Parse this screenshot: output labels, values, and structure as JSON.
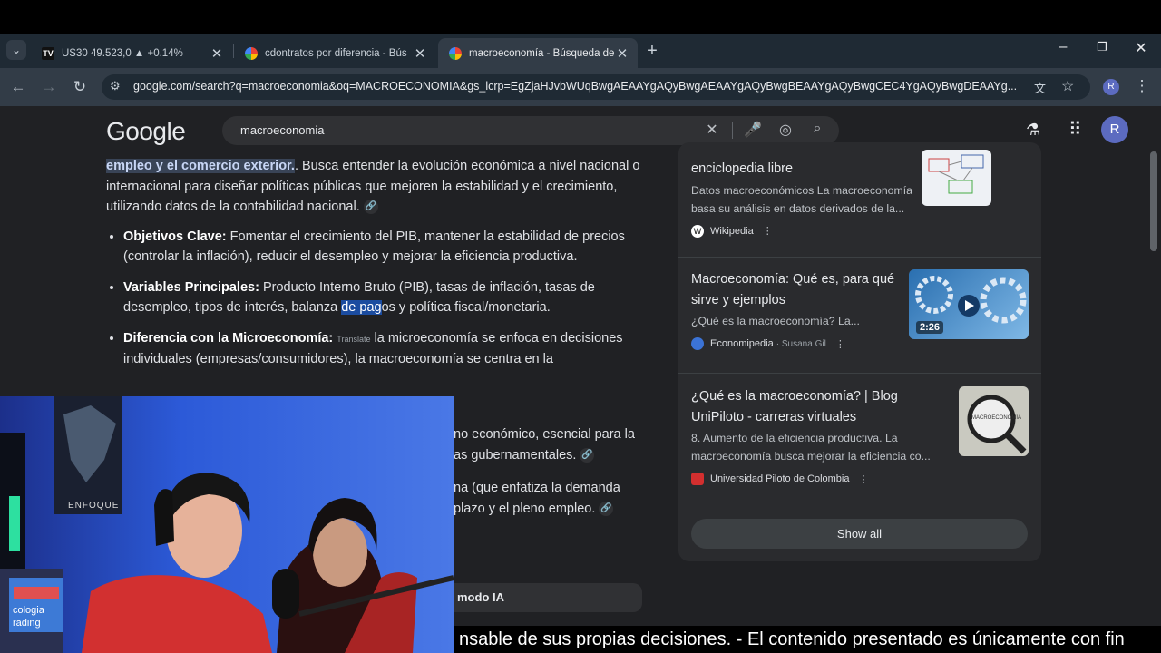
{
  "browser": {
    "tabs": [
      {
        "title": "US30 49.523,0 ▲ +0.14%",
        "active": false
      },
      {
        "title": "cdontratos por diferencia - Bús",
        "active": false
      },
      {
        "title": "macroeconomía - Búsqueda de",
        "active": true
      }
    ],
    "new_tab": "+",
    "url": "google.com/search?q=macroeconomia&oq=MACROECONOMIA&gs_lcrp=EgZjaHJvbWUqBwgAEAAYgAQyBwgAEAAYgAQyBwgBEAAYgAQyBwgCEC4YgAQyBwgDEAAYg...",
    "profile_initial": "R"
  },
  "google": {
    "logo": "Google",
    "query": "macroeconomia",
    "avatar": "R"
  },
  "article": {
    "intro_highlight": "empleo y el comercio exterior.",
    "intro_rest": ". Busca entender la evolución económica a nivel nacional o internacional para diseñar políticas públicas que mejoren la estabilidad y el crecimiento, utilizando datos de la contabilidad nacional.",
    "bullets": [
      {
        "label": "Objetivos Clave:",
        "text": " Fomentar el crecimiento del PIB, mantener la estabilidad de precios (controlar la inflación), reducir el desempleo y mejorar la eficiencia productiva."
      },
      {
        "label": "Variables Principales:",
        "text_a": " Producto Interno Bruto (PIB), tasas de inflación, tasas de desempleo, tipos de interés, balanza ",
        "text_sel": "de pag",
        "text_b": "os y política fiscal/monetaria."
      },
      {
        "label": "Diferencia con la Microeconomía:",
        "tooltip": "Translate",
        "text": " la microeconomía se enfoca en decisiones individuales (empresas/consumidores), la macroeconomía se centra en la"
      }
    ],
    "partial_line1a": "no económico, esencial para la",
    "partial_line1b": "as gubernamentales.",
    "partial_line2a": "na (que enfatiza la demanda",
    "partial_line2b": "plazo y el pleno empleo.",
    "ai_mode": "modo IA"
  },
  "sources": {
    "cards": [
      {
        "title": "enciclopedia libre",
        "snippet": "Datos macroeconómicos La macroeconomía basa su análisis en datos derivados de la...",
        "source": "Wikipedia",
        "author": "",
        "favicon_letter": "W"
      },
      {
        "title": "Macroeconomía: Qué es, para qué sirve y ejemplos",
        "snippet": "¿Qué es la macroeconomía? La...",
        "source": "Economipedia",
        "author": "· Susana Gil",
        "duration": "2:26"
      },
      {
        "title": "¿Qué es la macroeconomía? | Blog UniPiloto - carreras virtuales",
        "snippet": "8. Aumento de la eficiencia productiva. La macroeconomía busca mejorar la eficiencia co...",
        "source": "Universidad Piloto de Colombia",
        "author": "",
        "thumb_text": "MACROECONOMÍA"
      }
    ],
    "show_all": "Show all"
  },
  "webcam": {
    "poster_text": "ENFOQUE",
    "book_text_1": "cologia",
    "book_text_2": "rading"
  },
  "subtitle": "nsable de sus propias decisiones.  - El contenido presentado es únicamente con fin",
  "colors": {
    "page_bg": "#202124",
    "highlight": "#394457",
    "selection": "#1b4ca0",
    "avatar": "#5c6bc0"
  }
}
